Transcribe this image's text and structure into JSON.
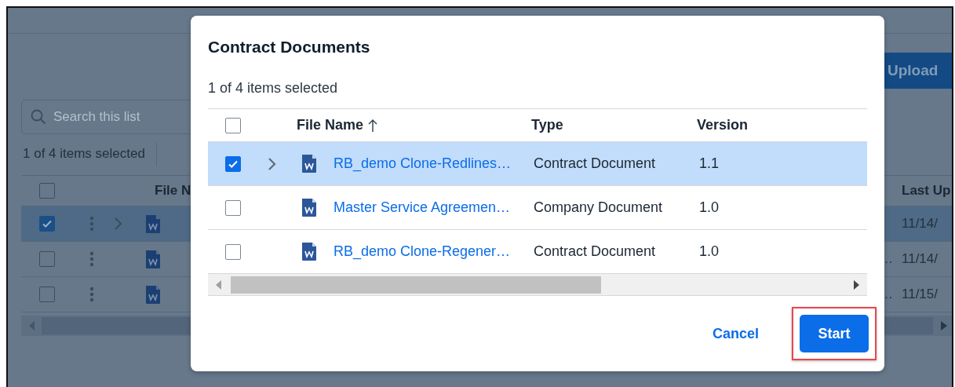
{
  "background": {
    "upload_button": "Upload",
    "search": {
      "placeholder": "Search this list"
    },
    "selection_count": "1 of 4 items selected",
    "table": {
      "header_checked": false,
      "columns": [
        "File N",
        "Last Up"
      ],
      "rows": [
        {
          "selected": true,
          "checked": true,
          "expandable": true,
          "date": "11/14/"
        },
        {
          "selected": false,
          "checked": false,
          "expandable": false,
          "overflow": "…",
          "date": "11/14/"
        },
        {
          "selected": false,
          "checked": false,
          "expandable": false,
          "overflow": "…",
          "date": "11/15/"
        }
      ]
    }
  },
  "dialog": {
    "title": "Contract Documents",
    "selection_count": "1 of 4 items selected",
    "table": {
      "header_checked": false,
      "columns": [
        {
          "label": "File Name",
          "sorted": true
        },
        {
          "label": "Type",
          "sorted": false
        },
        {
          "label": "Version",
          "sorted": false
        }
      ],
      "rows": [
        {
          "selected": true,
          "checked": true,
          "expandable": true,
          "file_name": "RB_demo Clone-Redlines…",
          "type": "Contract Document",
          "version": "1.1"
        },
        {
          "selected": false,
          "checked": false,
          "expandable": false,
          "file_name": "Master Service Agreemen…",
          "type": "Company Document",
          "version": "1.0"
        },
        {
          "selected": false,
          "checked": false,
          "expandable": false,
          "file_name": "RB_demo Clone-Regener…",
          "type": "Contract Document",
          "version": "1.0"
        }
      ]
    },
    "buttons": [
      {
        "label": "Cancel",
        "kind": "link",
        "highlighted": false
      },
      {
        "label": "Start",
        "kind": "primary",
        "highlighted": true
      }
    ]
  }
}
